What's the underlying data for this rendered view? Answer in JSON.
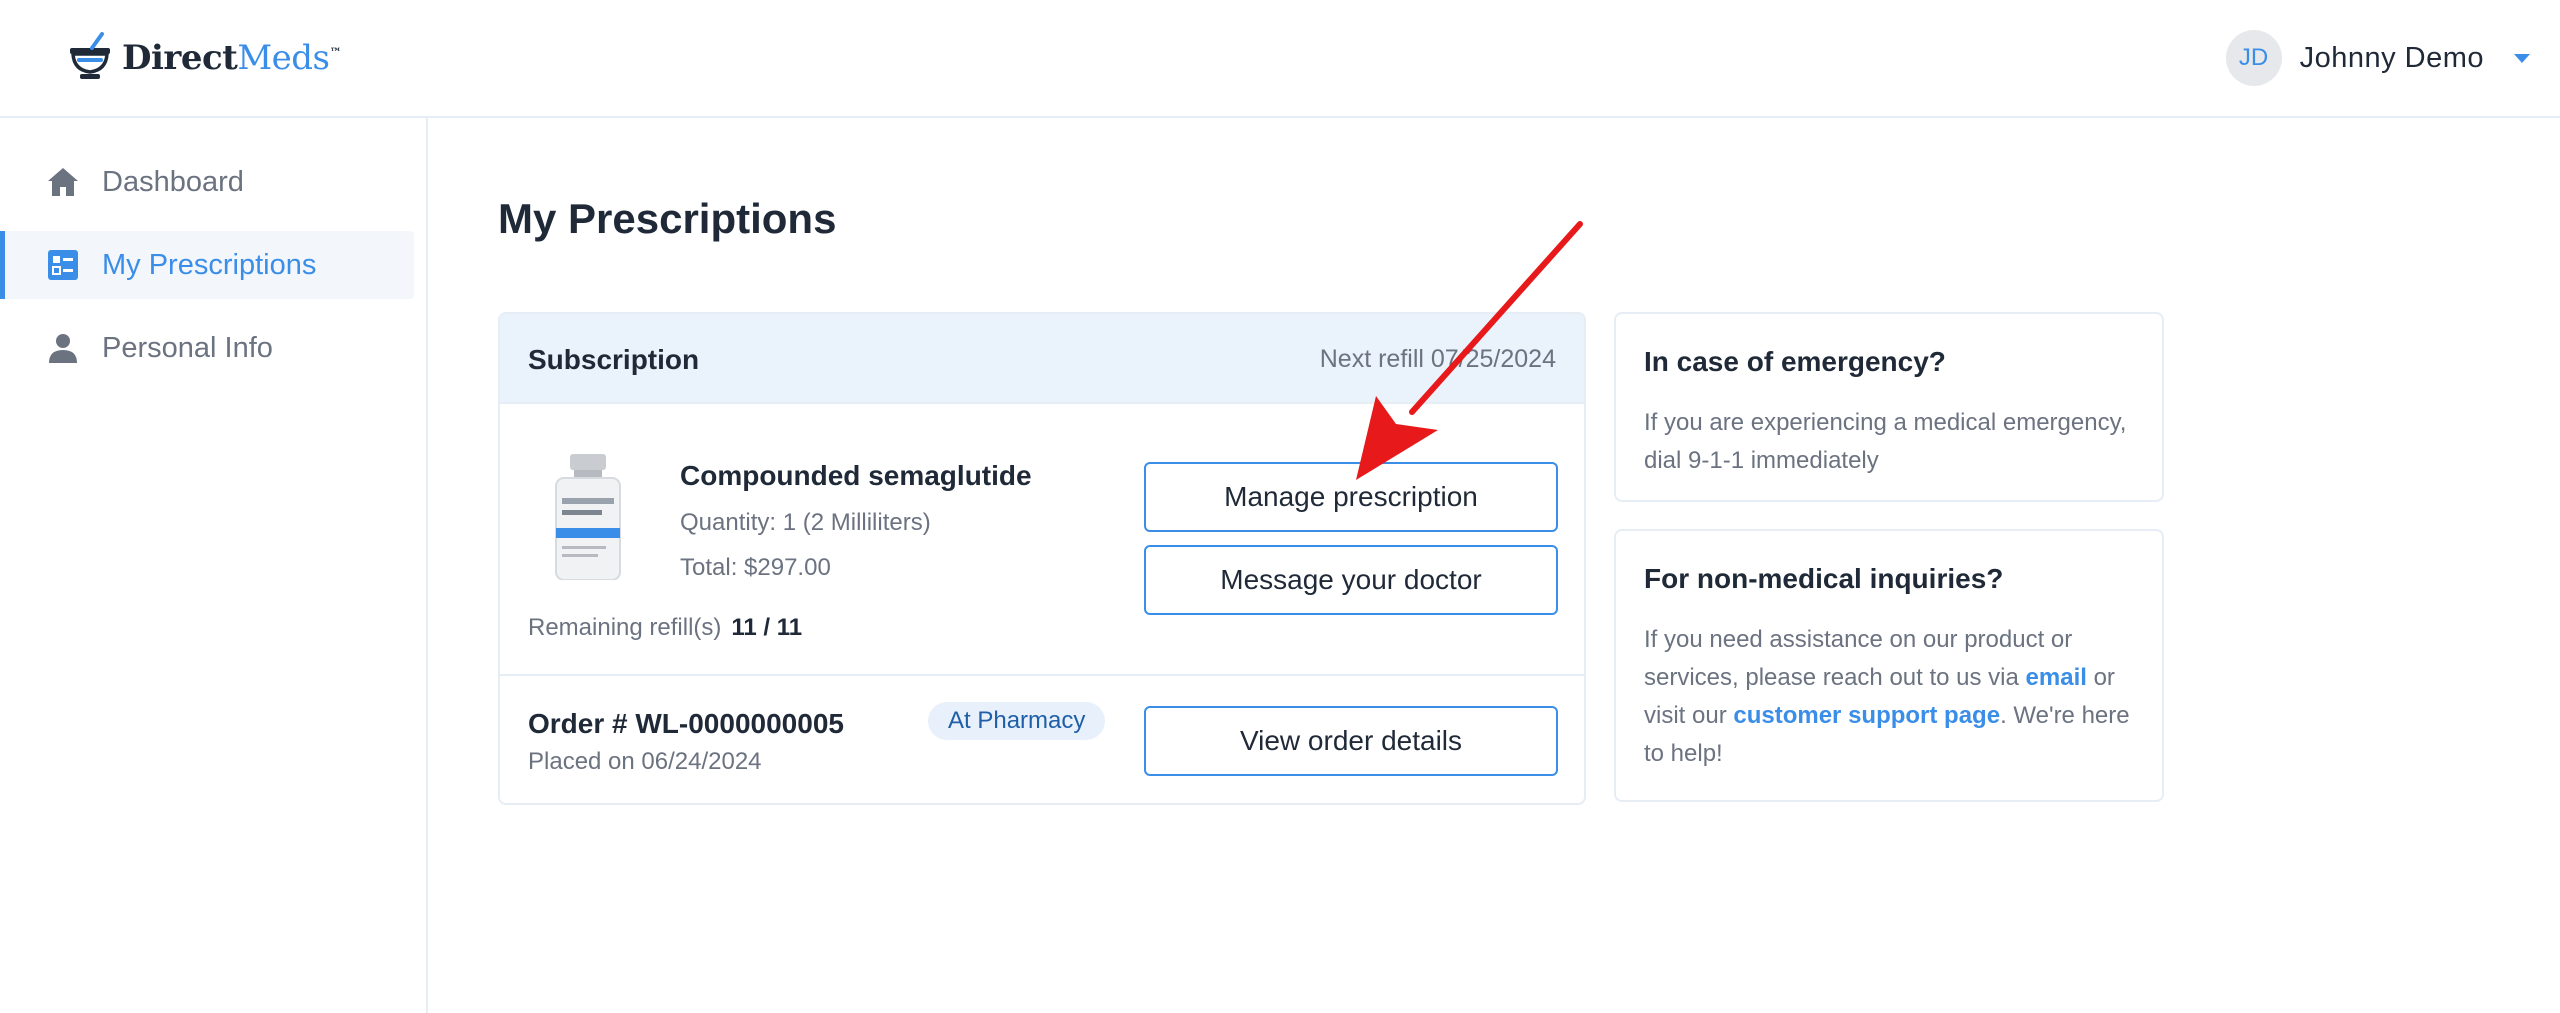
{
  "brand": {
    "name_part1": "Direct",
    "name_part2": "Meds",
    "trademark": "™"
  },
  "user": {
    "initials": "JD",
    "name": "Johnny Demo"
  },
  "sidebar": {
    "items": [
      {
        "label": "Dashboard",
        "icon": "home-icon"
      },
      {
        "label": "My Prescriptions",
        "icon": "list-icon",
        "active": true
      },
      {
        "label": "Personal Info",
        "icon": "person-icon"
      }
    ]
  },
  "page": {
    "title": "My Prescriptions"
  },
  "subscription": {
    "title": "Subscription",
    "next_refill": "Next refill 07/25/2024",
    "product_name": "Compounded semaglutide",
    "quantity": "Quantity: 1 (2 Milliliters)",
    "total": "Total: $297.00",
    "remaining_label": "Remaining refill(s)",
    "remaining_value": "11 / 11",
    "manage_button": "Manage prescription",
    "message_button": "Message your doctor",
    "order_number": "Order # WL-0000000005",
    "order_date": "Placed on 06/24/2024",
    "order_status": "At Pharmacy",
    "view_order_button": "View order details"
  },
  "emergency": {
    "title": "In case of emergency?",
    "text": "If you are experiencing a medical emergency, dial 9-1-1 immediately"
  },
  "inquiries": {
    "title": "For non-medical inquiries?",
    "text_1": "If you need assistance on our product or services, please reach out to us via ",
    "link_email": "email",
    "text_2": " or visit our ",
    "link_support": "customer support page",
    "text_3": ". We're here to help!"
  },
  "colors": {
    "accent": "#3b8ee8",
    "annotation_arrow": "#e8191a"
  }
}
